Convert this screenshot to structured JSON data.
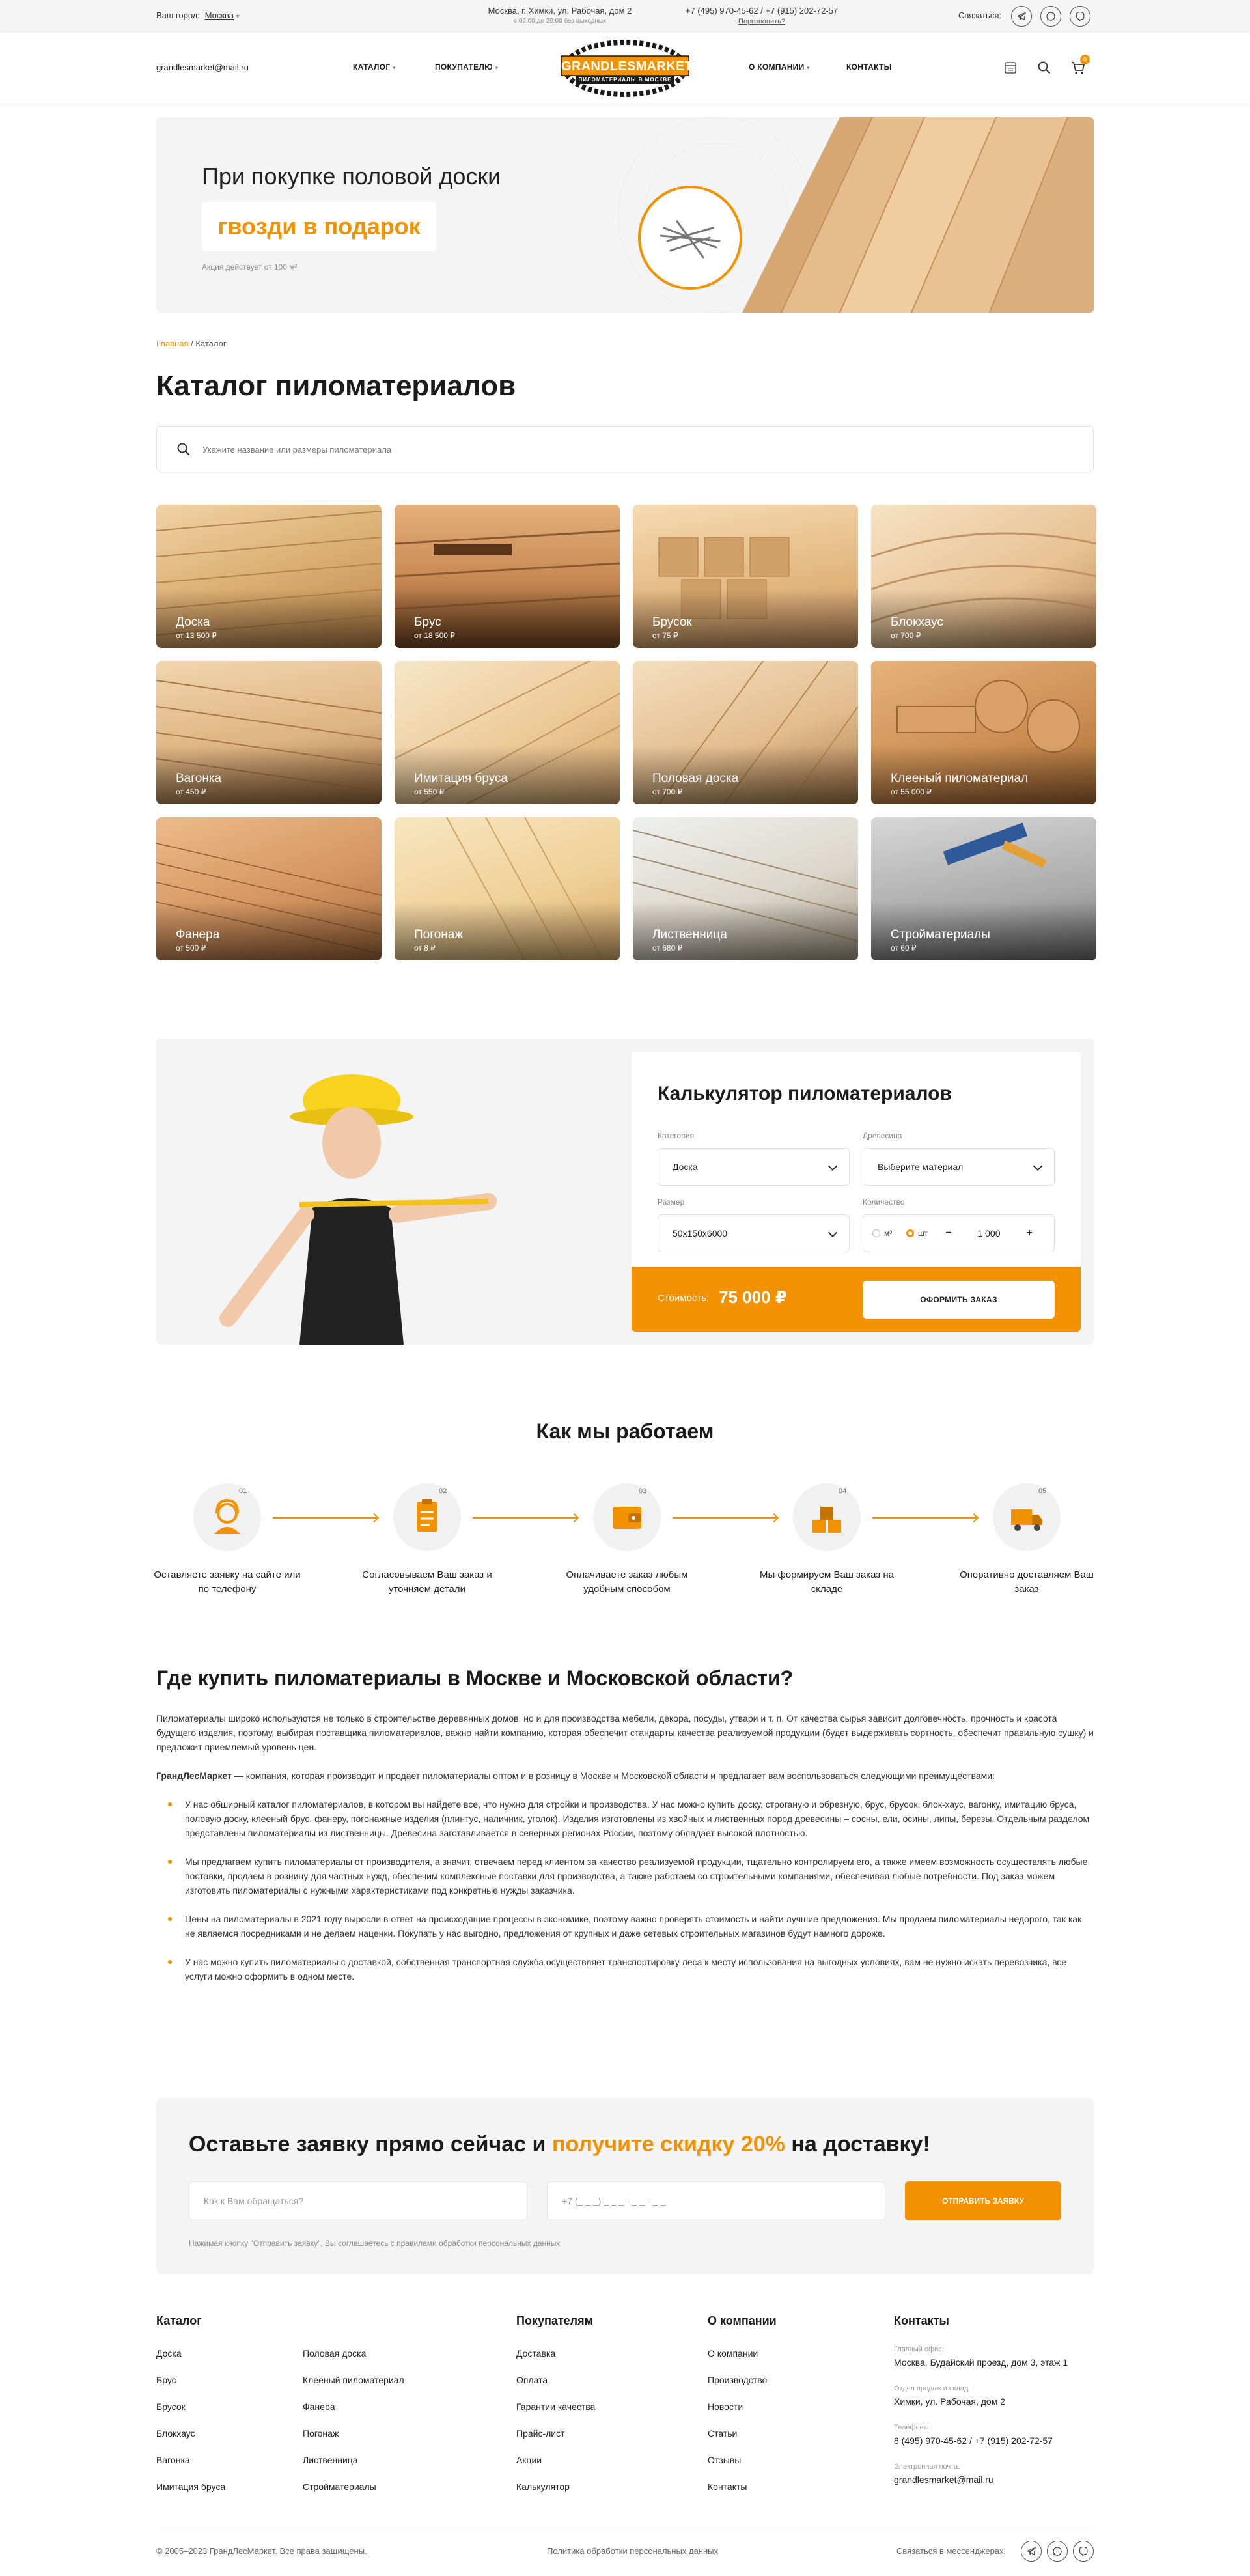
{
  "topbar": {
    "city_label": "Ваш город:",
    "city": "Москва",
    "address": "Москва, г. Химки, ул. Рабочая, дом 2",
    "hours": "с 09:00 до 20:00 без выходных",
    "phone1": "+7 (495) 970-45-62",
    "phone_sep": "/",
    "phone2": "+7 (915) 202-72-57",
    "callback": "Перезвонить?",
    "contact_label": "Связаться:"
  },
  "header": {
    "email": "grandlesmarket@mail.ru",
    "nav": [
      "КАТАЛОГ",
      "ПОКУПАТЕЛЮ",
      "О КОМПАНИИ",
      "КОНТАКТЫ"
    ],
    "logo_main": "GRANDLESMARKET.RU",
    "logo_sub": "ПИЛОМАТЕРИАЛЫ В МОСКВЕ",
    "cart_count": "0"
  },
  "promo": {
    "title": "При покупке половой доски",
    "gift": "гвозди в подарок",
    "note": "Акция действует от 100 м²"
  },
  "breadcrumb": {
    "home": "Главная",
    "sep": "/",
    "current": "Каталог"
  },
  "page_title": "Каталог пиломатериалов",
  "search": {
    "placeholder": "Укажите название или размеры пиломатериала"
  },
  "catalog": [
    {
      "name": "Доска",
      "price": "от 13 500 ₽"
    },
    {
      "name": "Брус",
      "price": "от 18 500 ₽"
    },
    {
      "name": "Брусок",
      "price": "от 75 ₽"
    },
    {
      "name": "Блокхаус",
      "price": "от 700 ₽"
    },
    {
      "name": "Вагонка",
      "price": "от 450 ₽"
    },
    {
      "name": "Имитация бруса",
      "price": "от 550 ₽"
    },
    {
      "name": "Половая доска",
      "price": "от 700 ₽"
    },
    {
      "name": "Клееный пиломатериал",
      "price": "от 55 000 ₽"
    },
    {
      "name": "Фанера",
      "price": "от 500 ₽"
    },
    {
      "name": "Погонаж",
      "price": "от 8 ₽"
    },
    {
      "name": "Лиственница",
      "price": "от 680 ₽"
    },
    {
      "name": "Стройматериалы",
      "price": "от 60 ₽"
    }
  ],
  "calculator": {
    "title": "Калькулятор пиломатериалов",
    "category_label": "Категория",
    "category_value": "Доска",
    "wood_label": "Древесина",
    "wood_value": "Выберите материал",
    "size_label": "Размер",
    "size_value": "50x150x6000",
    "qty_label": "Количество",
    "unit1": "м³",
    "unit2": "шт",
    "qty_value": "1 000",
    "minus": "−",
    "plus": "+",
    "cost_label": "Стоимость:",
    "cost_value": "75 000 ₽",
    "order_button": "ОФОРМИТЬ ЗАКАЗ"
  },
  "how": {
    "title": "Как мы работаем",
    "steps": [
      {
        "num": "01",
        "text": "Оставляете заявку на сайте или по телефону"
      },
      {
        "num": "02",
        "text": "Согласовываем Ваш заказ и уточняем детали"
      },
      {
        "num": "03",
        "text": "Оплачиваете заказ любым удобным способом"
      },
      {
        "num": "04",
        "text": "Мы формируем Ваш заказ на складе"
      },
      {
        "num": "05",
        "text": "Оперативно доставляем Ваш заказ"
      }
    ]
  },
  "seo": {
    "title": "Где купить пиломатериалы в Москве и Московской области?",
    "p1": "Пиломатериалы широко используются не только в строительстве деревянных домов, но и для производства мебели, декора, посуды, утвари и т. п. От качества сырья зависит долговечность, прочность и красота будущего изделия, поэтому, выбирая поставщика пиломатериалов, важно найти компанию, которая обеспечит стандарты качества реализуемой продукции (будет выдерживать сортность, обеспечит правильную сушку) и предложит приемлемый уровень цен.",
    "p2_bold": "ГрандЛесМаркет",
    "p2": " — компания, которая производит и продает пиломатериалы оптом и в розницу в Москве и Московской области и предлагает вам воспользоваться следующими преимуществами:",
    "items": [
      "У нас обширный каталог пиломатериалов, в котором вы найдете все, что нужно для стройки и производства. У нас можно купить доску, строганую и обрезную, брус, брусок, блок-хаус, вагонку, имитацию бруса, половую доску, клееный брус, фанеру, погонажные изделия (плинтус, наличник, уголок). Изделия изготовлены из хвойных и лиственных пород древесины – сосны, ели, осины, липы, березы. Отдельным разделом представлены пиломатериалы из лиственницы. Древесина заготавливается в северных регионах России, поэтому обладает высокой плотностью.",
      "Мы предлагаем купить пиломатериалы от производителя, а значит, отвечаем перед клиентом за качество реализуемой продукции, тщательно контролируем его, а также имеем возможность осуществлять любые поставки, продаем в розницу для частных нужд, обеспечим комплексные поставки для производства, а также работаем со строительными компаниями, обеспечивая любые потребности. Под заказ можем изготовить пиломатериалы с нужными характеристиками под конкретные нужды заказчика.",
      "Цены на пиломатериалы в 2021 году выросли в ответ на происходящие процессы в экономике, поэтому важно проверять стоимость и найти лучшие предложения. Мы продаем пиломатериалы недорого, так как не являемся посредниками и не делаем наценки. Покупать у нас выгодно, предложения от крупных и даже сетевых строительных магазинов будут намного дороже.",
      "У нас можно купить пиломатериалы с доставкой, собственная транспортная служба осуществляет транспортировку леса к месту использования на выгодных условиях, вам не нужно искать перевозчика, все услуги можно оформить в одном месте."
    ]
  },
  "lead": {
    "title_a": "Оставьте заявку прямо сейчас и ",
    "title_b": "получите скидку 20%",
    "title_c": " на доставку!",
    "name_placeholder": "Как к Вам обращаться?",
    "phone_placeholder": "+7 (_ _ _) _ _ _ - _ _ - _ _",
    "send": "ОТПРАВИТЬ ЗАЯВКУ",
    "agree": "Нажимая кнопку \"Отправить заявку\", Вы соглашаетесь с правилами обработки персональных данных"
  },
  "footer": {
    "catalog_title": "Каталог",
    "catalog_col1": [
      "Доска",
      "Брус",
      "Брусок",
      "Блокхаус",
      "Вагонка",
      "Имитация бруса"
    ],
    "catalog_col2": [
      "Половая доска",
      "Клееный пиломатериал",
      "Фанера",
      "Погонаж",
      "Лиственница",
      "Стройматериалы"
    ],
    "buyers_title": "Покупателям",
    "buyers": [
      "Доставка",
      "Оплата",
      "Гарантии качества",
      "Прайс-лист",
      "Акции",
      "Калькулятор"
    ],
    "company_title": "О компании",
    "company": [
      "О компании",
      "Производство",
      "Новости",
      "Статьи",
      "Отзывы",
      "Контакты"
    ],
    "contacts_title": "Контакты",
    "office_label": "Главный офис:",
    "office": "Москва, Будайский проезд, дом 3, этаж 1",
    "warehouse_label": "Отдел продаж и склад:",
    "warehouse": "Химки, ул. Рабочая, дом 2",
    "phones_label": "Телефоны:",
    "phones": "8 (495) 970-45-62  /  +7 (915) 202-72-57",
    "email_label": "Электронная почта:",
    "email": "grandlesmarket@mail.ru",
    "copyright": "© 2005–2023 ГрандЛесМаркет. Все права защищены.",
    "privacy": "Политика обработки персональных данных",
    "messengers": "Связаться в мессенджерах:"
  }
}
